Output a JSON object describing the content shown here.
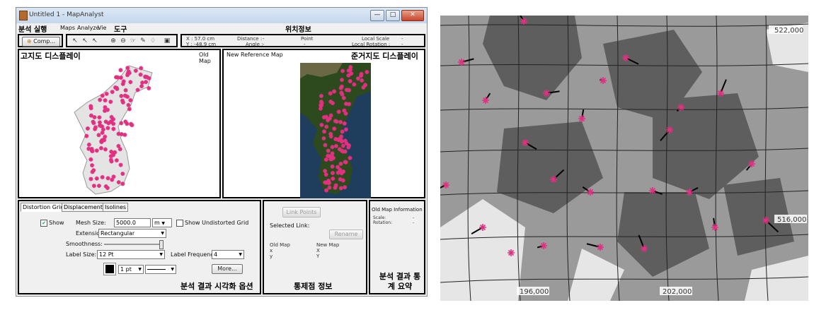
{
  "window": {
    "title": "Untitled 1 - MapAnalyst",
    "buttons": [
      "—",
      "□",
      "✕"
    ]
  },
  "menu": [
    "Maps",
    "Analyze",
    "Vie"
  ],
  "annotations": {
    "run": "분석 실행",
    "tools": "도구",
    "position": "위치정보",
    "old_map_display": "고지도 디스플레이",
    "ref_map_display": "준거지도 디스플레이",
    "viz_options": "분석 결과 시각화 옵션",
    "control_info": "통제점 정보",
    "summary": "분석 결과 통계 요약"
  },
  "toolbar": {
    "compute_label": "Comp...",
    "tools": [
      "↖",
      "↖",
      "↖",
      "⊕",
      "⊖",
      "☞",
      "✎",
      "♢",
      "▣"
    ]
  },
  "coords": {
    "x": "X : 57.0 cm",
    "y": "Y : -48.9 cm",
    "distance_label": "Distance :",
    "distance_value": "-",
    "angle_label": "Angle :",
    "angle_value": "-",
    "point_label": "Point",
    "point_value": "-",
    "local_scale_label": "Local Scale",
    "local_scale_value": "-",
    "local_rotation_label": "Local Rotation :",
    "local_rotation_value": "-"
  },
  "old_map": {
    "title": "Old Map"
  },
  "ref_map": {
    "title": "New Reference Map"
  },
  "options": {
    "tabs": [
      "Distortion Grid",
      "Displacements",
      "Isolines"
    ],
    "show_label": "Show",
    "show_checked": true,
    "mesh_size_label": "Mesh Size:",
    "mesh_size_value": "5000.0",
    "mesh_unit": "m",
    "undistorted_label": "Show Undistorted Grid",
    "extension_label": "Extension:",
    "extension_value": "Rectangular",
    "smoothness_label": "Smoothness:",
    "smoothness_level": 1.0,
    "label_size_label": "Label Size:",
    "label_size_value": "12 Pt",
    "label_freq_label": "Label Frequency:",
    "label_freq_value": "4",
    "line_width": "1 pt",
    "more_label": "More..."
  },
  "link": {
    "link_points": "Link Points",
    "selected_link": "Selected Link:",
    "rename": "Rename",
    "old_map": "Old Map",
    "new_map": "New Map",
    "x_old": "x",
    "x_new": "X",
    "y_old": "y",
    "y_new": "Y"
  },
  "info": {
    "title": "Old Map Information",
    "scale_label": "Scale:",
    "scale_value": "-",
    "rotation_label": "Rotation:",
    "rotation_value": "-"
  },
  "detail_map": {
    "labels": [
      "522,000",
      "516,000",
      "196,000",
      "202,000"
    ]
  },
  "colors": {
    "point": "#e0307f",
    "satellite": "#2d4a1f"
  }
}
